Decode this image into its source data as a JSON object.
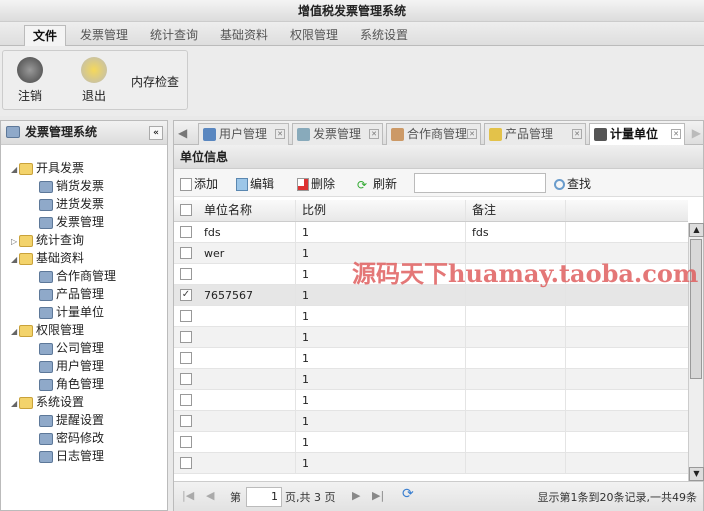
{
  "app": {
    "title": "增值税发票管理系统"
  },
  "menu": [
    "文件",
    "发票管理",
    "统计查询",
    "基础资料",
    "权限管理",
    "系统设置"
  ],
  "ribbon": {
    "logout": "注销",
    "exit": "退出",
    "memory_check": "内存检查"
  },
  "sidebar": {
    "title": "发票管理系统",
    "collapse": "«",
    "items": [
      {
        "label": "开具发票",
        "level": 0,
        "folder": true,
        "open": true
      },
      {
        "label": "销货发票",
        "level": 1
      },
      {
        "label": "进货发票",
        "level": 1
      },
      {
        "label": "发票管理",
        "level": 1
      },
      {
        "label": "统计查询",
        "level": 0,
        "folder": true,
        "open": false
      },
      {
        "label": "基础资料",
        "level": 0,
        "folder": true,
        "open": true
      },
      {
        "label": "合作商管理",
        "level": 1
      },
      {
        "label": "产品管理",
        "level": 1
      },
      {
        "label": "计量单位",
        "level": 1
      },
      {
        "label": "权限管理",
        "level": 0,
        "folder": true,
        "open": true
      },
      {
        "label": "公司管理",
        "level": 1
      },
      {
        "label": "用户管理",
        "level": 1
      },
      {
        "label": "角色管理",
        "level": 1
      },
      {
        "label": "系统设置",
        "level": 0,
        "folder": true,
        "open": true
      },
      {
        "label": "提醒设置",
        "level": 1
      },
      {
        "label": "密码修改",
        "level": 1
      },
      {
        "label": "日志管理",
        "level": 1
      }
    ]
  },
  "tabs": [
    {
      "label": "用户管理"
    },
    {
      "label": "发票管理"
    },
    {
      "label": "合作商管理"
    },
    {
      "label": "产品管理"
    },
    {
      "label": "计量单位",
      "active": true
    }
  ],
  "panel": {
    "title": "单位信息"
  },
  "toolbar": {
    "add": "添加",
    "edit": "编辑",
    "delete": "删除",
    "refresh": "刷新",
    "search_value": "",
    "find": "查找"
  },
  "table": {
    "columns": [
      "单位名称",
      "比例",
      "备注"
    ],
    "rows": [
      {
        "name": "fds",
        "ratio": "1",
        "note": "fds",
        "checked": false
      },
      {
        "name": "wer",
        "ratio": "1",
        "note": "",
        "checked": false
      },
      {
        "name": "",
        "ratio": "1",
        "note": "",
        "checked": false
      },
      {
        "name": "7657567",
        "ratio": "1",
        "note": "",
        "checked": true
      },
      {
        "name": "",
        "ratio": "1",
        "note": "",
        "checked": false
      },
      {
        "name": "",
        "ratio": "1",
        "note": "",
        "checked": false
      },
      {
        "name": "",
        "ratio": "1",
        "note": "",
        "checked": false
      },
      {
        "name": "",
        "ratio": "1",
        "note": "",
        "checked": false
      },
      {
        "name": "",
        "ratio": "1",
        "note": "",
        "checked": false
      },
      {
        "name": "",
        "ratio": "1",
        "note": "",
        "checked": false
      },
      {
        "name": "",
        "ratio": "1",
        "note": "",
        "checked": false
      },
      {
        "name": "",
        "ratio": "1",
        "note": "",
        "checked": false
      }
    ]
  },
  "pager": {
    "page_prefix": "第",
    "page": "1",
    "page_suffix": "页,共 3 页",
    "summary": "显示第1条到20条记录,一共49条"
  },
  "watermark": "源码天下huamay.taoba.com"
}
